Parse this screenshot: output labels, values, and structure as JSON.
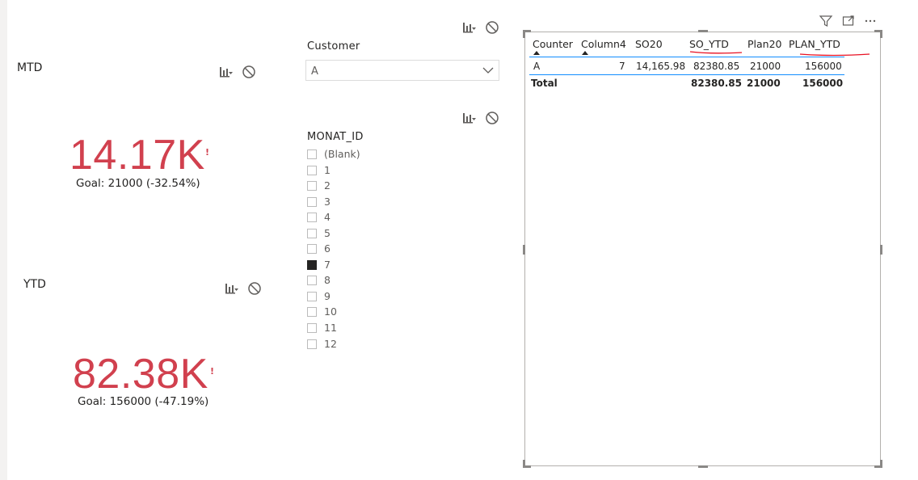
{
  "mtd": {
    "title": "MTD",
    "value": "14.17K",
    "alert": "!",
    "goal": "Goal: 21000 (-32.54%)"
  },
  "ytd": {
    "title": "YTD",
    "value": "82.38K",
    "alert": "!",
    "goal": "Goal: 156000 (-47.19%)"
  },
  "customer_slicer": {
    "title": "Customer",
    "selected": "A"
  },
  "monat_slicer": {
    "title": "MONAT_ID",
    "items": [
      {
        "label": "(Blank)",
        "checked": false
      },
      {
        "label": "1",
        "checked": false
      },
      {
        "label": "2",
        "checked": false
      },
      {
        "label": "3",
        "checked": false
      },
      {
        "label": "4",
        "checked": false
      },
      {
        "label": "5",
        "checked": false
      },
      {
        "label": "6",
        "checked": false
      },
      {
        "label": "7",
        "checked": true
      },
      {
        "label": "8",
        "checked": false
      },
      {
        "label": "9",
        "checked": false
      },
      {
        "label": "10",
        "checked": false
      },
      {
        "label": "11",
        "checked": false
      },
      {
        "label": "12",
        "checked": false
      }
    ]
  },
  "table": {
    "columns": [
      "Counter",
      "Column4",
      "SO20",
      "SO_YTD",
      "Plan20",
      "PLAN_YTD"
    ],
    "rows": [
      [
        "A",
        "7",
        "14,165.98",
        "82380.85",
        "21000",
        "156000"
      ]
    ],
    "total": [
      "Total",
      "",
      "",
      "82380.85",
      "21000",
      "156000"
    ]
  },
  "colors": {
    "kpi_red": "#d1404e",
    "accent_teal": "#118dff",
    "annotation_red": "#e81123"
  },
  "icons": [
    "analytics-icon",
    "no-filter-icon",
    "filter-icon",
    "focus-mode-icon",
    "more-options-icon",
    "chevron-down-icon"
  ]
}
